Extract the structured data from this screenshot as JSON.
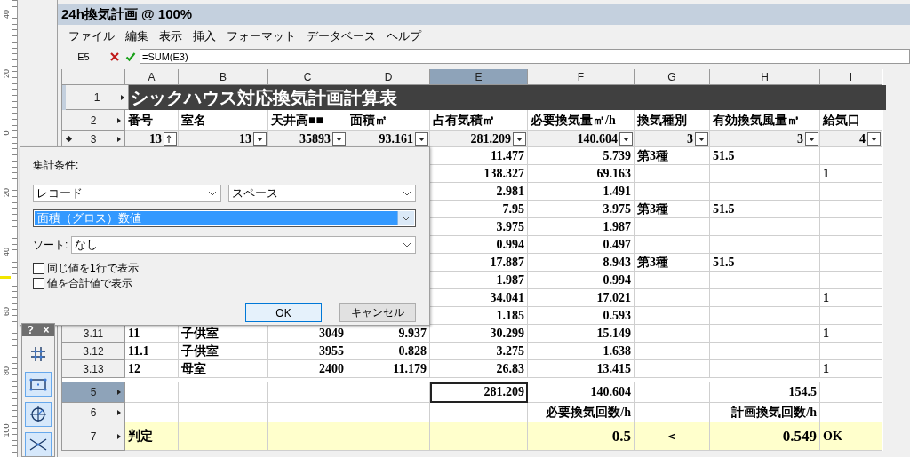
{
  "ruler": {
    "labels": [
      "40",
      "20",
      "0",
      "20",
      "40",
      "60",
      "80",
      "100"
    ]
  },
  "window": {
    "title": "24h換気計画 @ 100%"
  },
  "menu": [
    "ファイル",
    "編集",
    "表示",
    "挿入",
    "フォーマット",
    "データベース",
    "ヘルプ"
  ],
  "formula_bar": {
    "cell": "E5",
    "value": "=SUM(E3)"
  },
  "sheet": {
    "columns": [
      {
        "label": "A",
        "selected": false
      },
      {
        "label": "B",
        "selected": false
      },
      {
        "label": "C",
        "selected": false
      },
      {
        "label": "D",
        "selected": false
      },
      {
        "label": "E",
        "selected": true
      },
      {
        "label": "F",
        "selected": false
      },
      {
        "label": "G",
        "selected": false
      },
      {
        "label": "H",
        "selected": false
      },
      {
        "label": "I",
        "selected": false
      }
    ],
    "rows": [
      {
        "kind": "title",
        "header": "1",
        "selected": false,
        "title": "シックハウス対応換気計画計算表"
      },
      {
        "kind": "heading",
        "header": "2",
        "selected": false,
        "cells": [
          "番号",
          "室名",
          "天井高■■",
          "面積㎡",
          "占有気積㎥",
          "必要換気量㎥/h",
          "換気種別",
          "有効換気風量㎥",
          "給気口"
        ]
      },
      {
        "kind": "criteria",
        "header": "3",
        "selected": false,
        "cells": [
          "13",
          "13",
          "35893",
          "93.161",
          "281.209",
          "140.604",
          "3",
          "3",
          "4"
        ]
      },
      {
        "kind": "data",
        "cells": [
          null,
          null,
          null,
          null,
          "11.477",
          "5.739",
          "第3種",
          "51.5",
          null
        ]
      },
      {
        "kind": "data",
        "cells": [
          null,
          null,
          null,
          null,
          "138.327",
          "69.163",
          null,
          null,
          "1"
        ]
      },
      {
        "kind": "data",
        "cells": [
          null,
          null,
          null,
          null,
          "2.981",
          "1.491",
          null,
          null,
          null
        ]
      },
      {
        "kind": "data",
        "cells": [
          null,
          null,
          null,
          null,
          "7.95",
          "3.975",
          "第3種",
          "51.5",
          null
        ]
      },
      {
        "kind": "data",
        "cells": [
          null,
          null,
          null,
          null,
          "3.975",
          "1.987",
          null,
          null,
          null
        ]
      },
      {
        "kind": "data",
        "cells": [
          null,
          null,
          null,
          null,
          "0.994",
          "0.497",
          null,
          null,
          null
        ]
      },
      {
        "kind": "data",
        "cells": [
          null,
          null,
          null,
          null,
          "17.887",
          "8.943",
          "第3種",
          "51.5",
          null
        ]
      },
      {
        "kind": "data",
        "cells": [
          null,
          null,
          null,
          null,
          "1.987",
          "0.994",
          null,
          null,
          null
        ]
      },
      {
        "kind": "data",
        "cells": [
          null,
          null,
          null,
          null,
          "34.041",
          "17.021",
          null,
          null,
          "1"
        ]
      },
      {
        "kind": "data",
        "cells": [
          null,
          null,
          null,
          null,
          "1.185",
          "0.593",
          null,
          null,
          null
        ]
      },
      {
        "kind": "data",
        "header": "3.11",
        "selected": false,
        "cells": [
          "11",
          "子供室",
          "3049",
          "9.937",
          "30.299",
          "15.149",
          null,
          null,
          "1"
        ]
      },
      {
        "kind": "data",
        "header": "3.12",
        "selected": false,
        "cells": [
          "11.1",
          "子供室",
          "3955",
          "0.828",
          "3.275",
          "1.638",
          null,
          null,
          null
        ]
      },
      {
        "kind": "data",
        "header": "3.13",
        "selected": false,
        "cells": [
          "12",
          "母室",
          "2400",
          "11.179",
          "26.83",
          "13.415",
          null,
          null,
          "1"
        ]
      },
      {
        "kind": "total",
        "header": "5",
        "selected": true,
        "cells": [
          null,
          null,
          null,
          null,
          {
            "text": "281.209",
            "active": true
          },
          "140.604",
          null,
          "154.5",
          null
        ]
      },
      {
        "kind": "label",
        "header": "6",
        "selected": false,
        "cells": [
          null,
          null,
          null,
          null,
          null,
          "必要換気回数/h",
          null,
          "計画換気回数/h",
          null
        ]
      },
      {
        "kind": "verdict",
        "header": "7",
        "selected": false,
        "cells": [
          "判定",
          null,
          null,
          null,
          null,
          "0.5",
          "＜",
          "0.549",
          "OK"
        ]
      }
    ]
  },
  "dialog": {
    "label": "集計条件:",
    "selects": [
      {
        "value": "レコード",
        "highlighted": false
      },
      {
        "value": "スペース",
        "highlighted": false
      },
      {
        "value": "面積（グロス）数値",
        "highlighted": true
      }
    ],
    "sort": {
      "label": "ソート:",
      "value": "なし"
    },
    "checkboxes": [
      {
        "label": "同じ値を1行で表示",
        "checked": false
      },
      {
        "label": "値を合計値で表示",
        "checked": false
      }
    ],
    "buttons": [
      {
        "label": "OK",
        "default": true
      },
      {
        "label": "キャンセル",
        "default": false
      }
    ]
  },
  "palette": {
    "help": "?",
    "close": "×",
    "tools": [
      {
        "kind": "grid",
        "selected": false
      },
      {
        "kind": "rectangle",
        "selected": true
      },
      {
        "kind": "circle",
        "selected": true
      },
      {
        "kind": "cross",
        "selected": true
      }
    ]
  }
}
